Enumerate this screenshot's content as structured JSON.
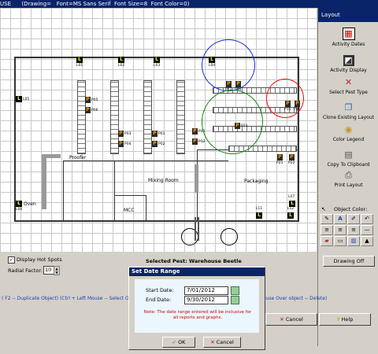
{
  "titlebar": {
    "text": "USE      (Drawing=   Font=MS Sans Serif  Font Size=8  Font Color=0)"
  },
  "floorplan": {
    "rooms": {
      "proofer": "Proofer",
      "oven": "Oven",
      "mixing": "Mixing Room",
      "mcc": "MCC",
      "packaging": "Packaging"
    },
    "lights": [
      "L01",
      "L02",
      "L03",
      "L04",
      "L05",
      "L06",
      "L07",
      "L11",
      "L12"
    ],
    "pests": [
      "P05",
      "P06",
      "P03",
      "P04",
      "P01",
      "P02",
      "P11",
      "P12",
      "P13",
      "P14",
      "P15",
      "P16",
      "P21",
      "P22",
      "P23"
    ]
  },
  "panel": {
    "title": "Layout",
    "buttons": [
      {
        "label": "Activity Dates"
      },
      {
        "label": "Activity Display"
      },
      {
        "label": "Select Pest Type"
      },
      {
        "label": "Clone Existing Layout"
      },
      {
        "label": "Color Legend"
      },
      {
        "label": "Copy To Clipboard"
      },
      {
        "label": "Print Layout"
      }
    ],
    "object_color": "Object Color:",
    "drawing_off": "Drawing Off"
  },
  "controls": {
    "display_hot_spots": "Display Hot Spots",
    "radial_factor_label": "Radial Factor:",
    "radial_factor_value": "10",
    "selected_pest": "Selected Pest:  Warehouse Beetle",
    "hint_line": "( F2 -- Duplicate Object)  (Ctrl + Left Mouse -- Select Obj",
    "hint_line_right": "ouse Over object -- Delete)",
    "cancel": "Cancel",
    "help": "Help"
  },
  "dialog": {
    "title": "Set Date Range",
    "start_label": "Start Date:",
    "start_value": "7/01/2012",
    "end_label": "End Date:",
    "end_value": "9/30/2012",
    "note": "Note:  The date range entered will be inclusive for all reports and graphs.",
    "ok": "OK",
    "cancel": "Cancel"
  },
  "colors": {
    "circle_blue": "#1f2fd6",
    "circle_red": "#e01010",
    "circle_green": "#0f8a1c"
  }
}
